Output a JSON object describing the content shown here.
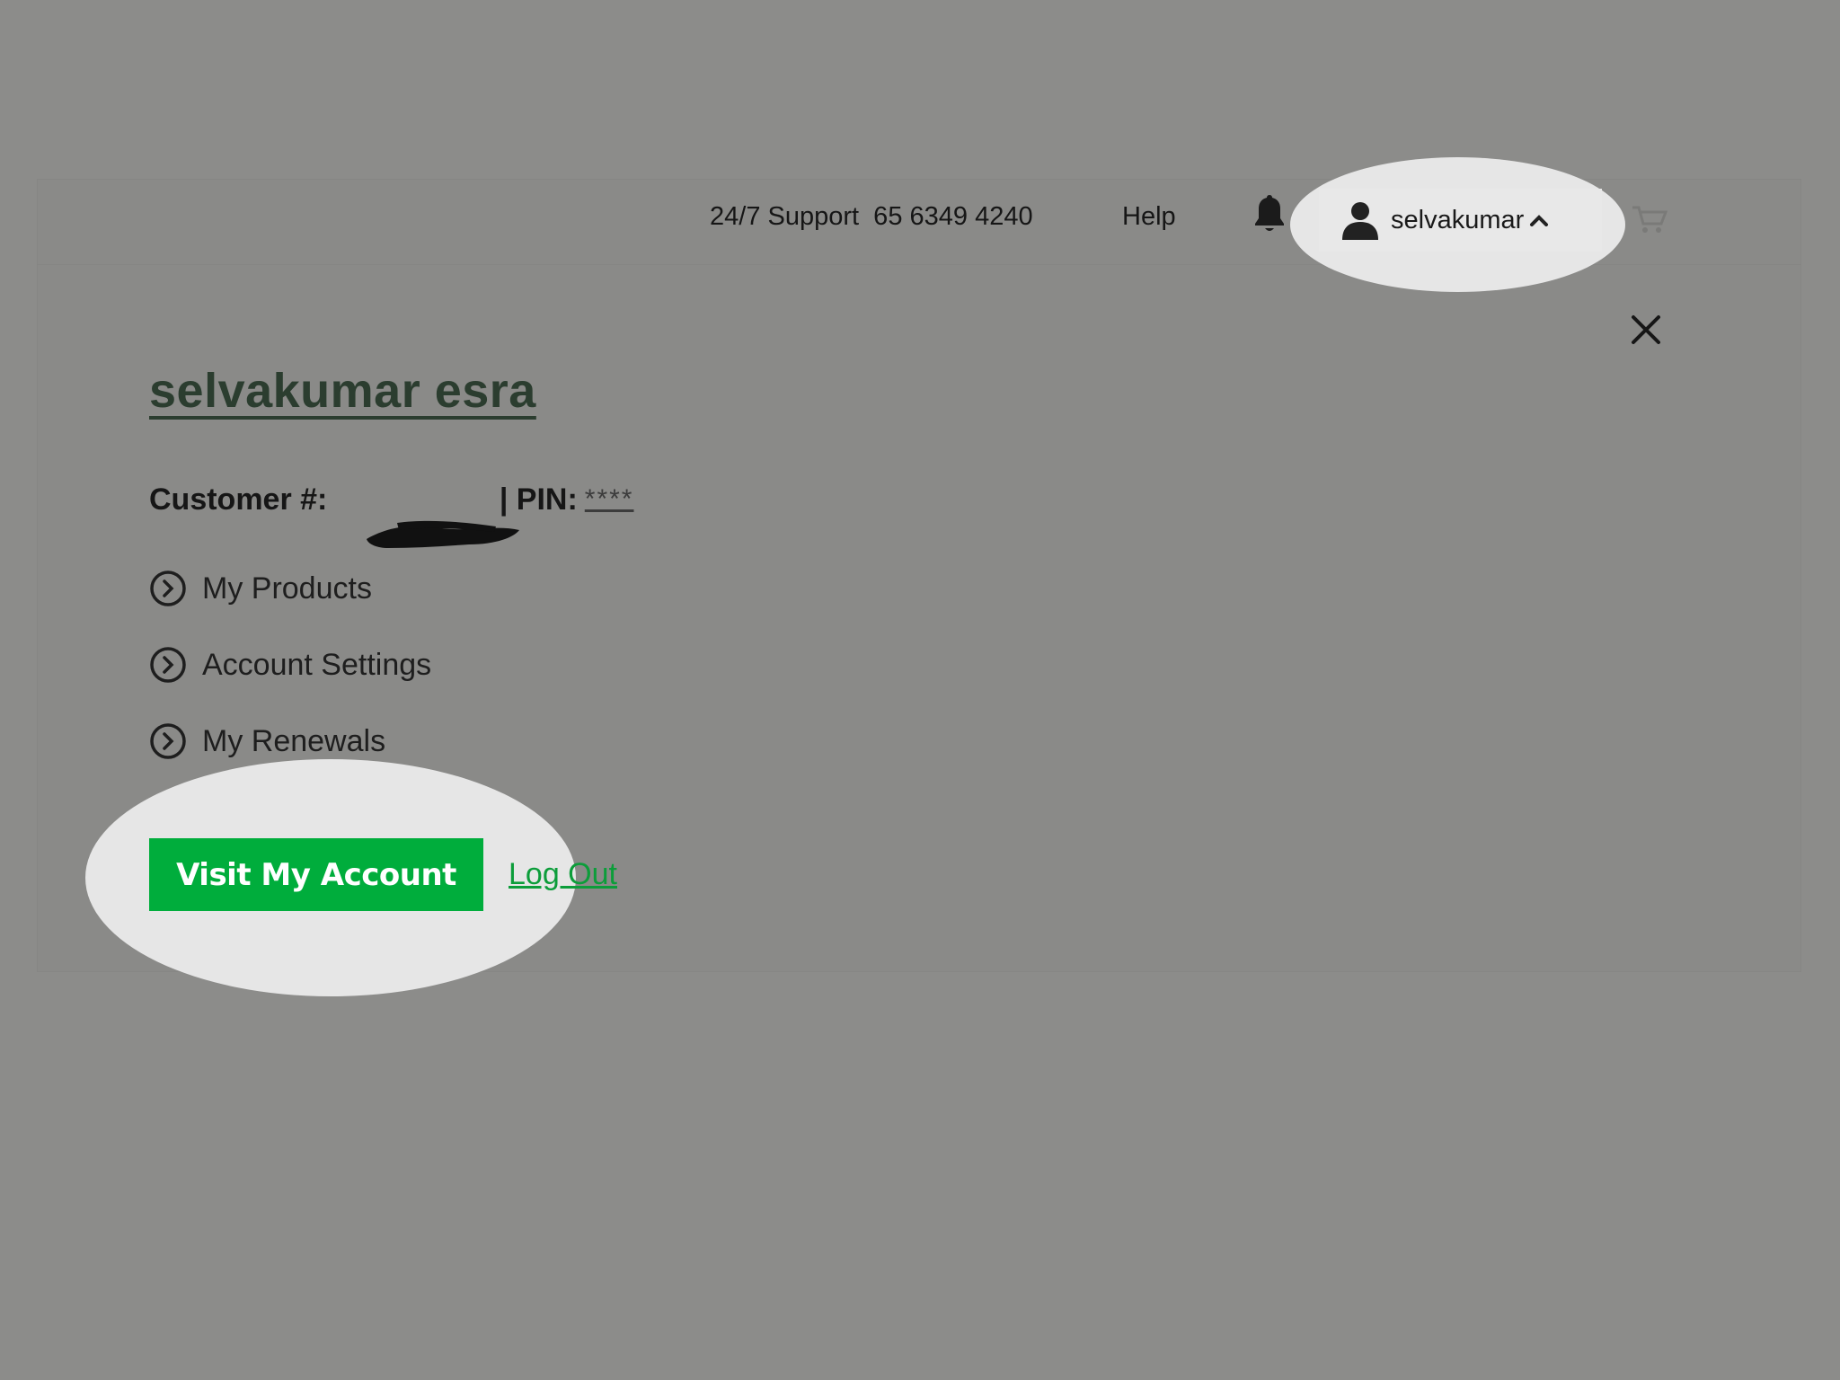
{
  "header": {
    "support_text": "24/7 Support  65 6349 4240",
    "help_label": "Help",
    "username": "selvakumar",
    "icons": [
      "bell-icon",
      "person-icon",
      "chevron-up-icon",
      "cart-icon"
    ]
  },
  "account_panel": {
    "full_name": "selvakumar esra",
    "customer_label": "Customer #:",
    "separator": " | ",
    "pin_label": "PIN:",
    "pin_value": "****",
    "menu": [
      {
        "label": "My Products",
        "icon": "chevron-circle-icon"
      },
      {
        "label": "Account Settings",
        "icon": "chevron-circle-icon"
      },
      {
        "label": "My Renewals",
        "icon": "chevron-circle-icon"
      }
    ],
    "visit_button_label": "Visit My Account",
    "logout_label": "Log Out",
    "close_icon": "close-icon"
  },
  "colors": {
    "overlay_bg": "#8c8c8a",
    "highlight": "#e6e6e6",
    "primary_green": "#00ad3c",
    "name_color": "#2b3d2f",
    "link_green": "#0c9d3a"
  }
}
